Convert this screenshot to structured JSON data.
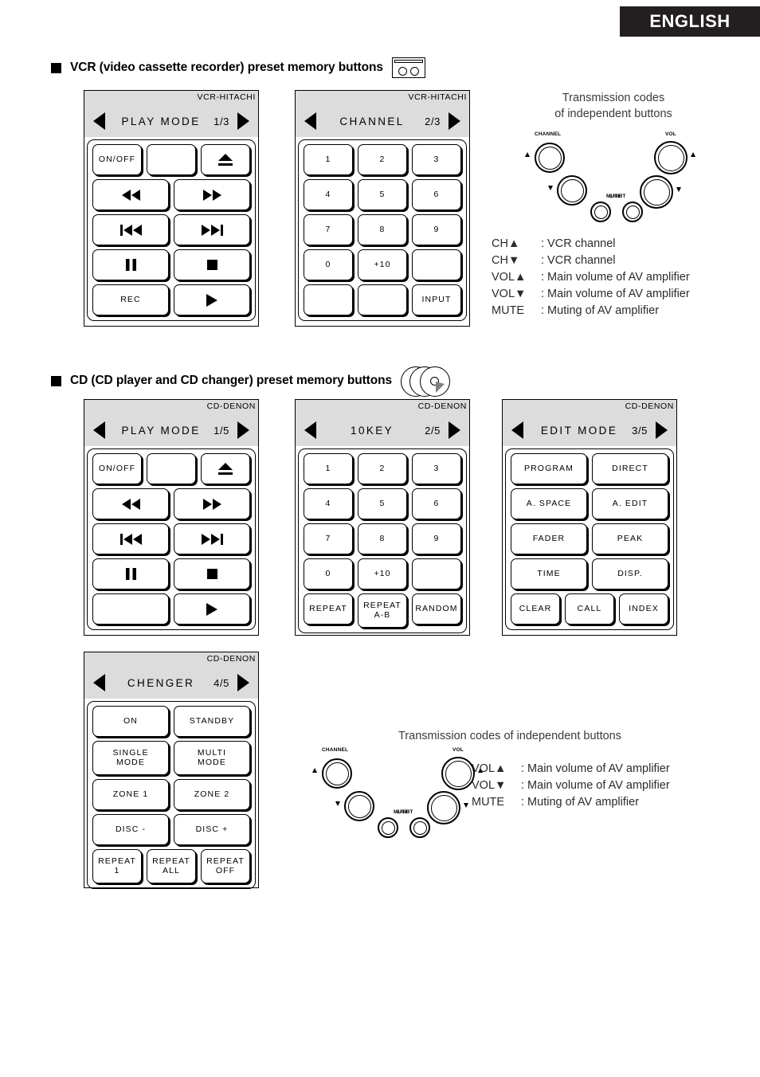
{
  "header": {
    "language": "ENGLISH"
  },
  "sections": [
    {
      "bullet_icon": "vhs-cassette-icon",
      "title": "VCR (video cassette recorder) preset memory buttons"
    },
    {
      "bullet_icon": "cd-discs-icon",
      "title": "CD (CD player and CD changer) preset memory buttons"
    }
  ],
  "vcr_panels": [
    {
      "brand": "VCR-HITACHI",
      "name": "PLAY MODE",
      "page": "1/3",
      "prev_icon": "triangle-left-icon",
      "next_icon": "triangle-right-icon",
      "rows": [
        [
          {
            "label": "ON/OFF",
            "type": "text",
            "span": 1
          },
          {
            "label": "",
            "type": "text",
            "span": 1
          },
          {
            "label": "",
            "type": "eject",
            "span": 1
          }
        ],
        [
          {
            "label": "",
            "type": "rew",
            "span": 2
          },
          {
            "label": "",
            "type": "ff",
            "span": 2
          }
        ],
        [
          {
            "label": "",
            "type": "prev",
            "span": 2
          },
          {
            "label": "",
            "type": "next",
            "span": 2
          }
        ],
        [
          {
            "label": "",
            "type": "pause",
            "span": 2
          },
          {
            "label": "",
            "type": "stop",
            "span": 2
          }
        ],
        [
          {
            "label": "REC",
            "type": "text",
            "span": 2
          },
          {
            "label": "",
            "type": "play",
            "span": 2
          }
        ]
      ]
    },
    {
      "brand": "VCR-HITACHI",
      "name": "CHANNEL",
      "page": "2/3",
      "prev_icon": "triangle-left-icon",
      "next_icon": "triangle-right-icon",
      "rows": [
        [
          {
            "label": "1",
            "type": "text",
            "span": 1
          },
          {
            "label": "2",
            "type": "text",
            "span": 1
          },
          {
            "label": "3",
            "type": "text",
            "span": 1
          }
        ],
        [
          {
            "label": "4",
            "type": "text",
            "span": 1
          },
          {
            "label": "5",
            "type": "text",
            "span": 1
          },
          {
            "label": "6",
            "type": "text",
            "span": 1
          }
        ],
        [
          {
            "label": "7",
            "type": "text",
            "span": 1
          },
          {
            "label": "8",
            "type": "text",
            "span": 1
          },
          {
            "label": "9",
            "type": "text",
            "span": 1
          }
        ],
        [
          {
            "label": "0",
            "type": "text",
            "span": 1
          },
          {
            "label": "+10",
            "type": "text",
            "span": 1
          },
          {
            "label": "",
            "type": "text",
            "span": 1
          }
        ],
        [
          {
            "label": "",
            "type": "text",
            "span": 1
          },
          {
            "label": "",
            "type": "text",
            "span": 1
          },
          {
            "label": "INPUT",
            "type": "text",
            "span": 1
          }
        ]
      ]
    }
  ],
  "cd_panels": [
    {
      "brand": "CD-DENON",
      "name": "PLAY MODE",
      "page": "1/5",
      "prev_icon": "triangle-left-icon",
      "next_icon": "triangle-right-icon",
      "rows": [
        [
          {
            "label": "ON/OFF",
            "type": "text",
            "span": 1
          },
          {
            "label": "",
            "type": "text",
            "span": 1
          },
          {
            "label": "",
            "type": "eject",
            "span": 1
          }
        ],
        [
          {
            "label": "",
            "type": "rew",
            "span": 2
          },
          {
            "label": "",
            "type": "ff",
            "span": 2
          }
        ],
        [
          {
            "label": "",
            "type": "prev",
            "span": 2
          },
          {
            "label": "",
            "type": "next",
            "span": 2
          }
        ],
        [
          {
            "label": "",
            "type": "pause",
            "span": 2
          },
          {
            "label": "",
            "type": "stop",
            "span": 2
          }
        ],
        [
          {
            "label": "",
            "type": "text",
            "span": 2
          },
          {
            "label": "",
            "type": "play",
            "span": 2
          }
        ]
      ]
    },
    {
      "brand": "CD-DENON",
      "name": "10KEY",
      "page": "2/5",
      "prev_icon": "triangle-left-icon",
      "next_icon": "triangle-right-icon",
      "rows": [
        [
          {
            "label": "1",
            "type": "text",
            "span": 1
          },
          {
            "label": "2",
            "type": "text",
            "span": 1
          },
          {
            "label": "3",
            "type": "text",
            "span": 1
          }
        ],
        [
          {
            "label": "4",
            "type": "text",
            "span": 1
          },
          {
            "label": "5",
            "type": "text",
            "span": 1
          },
          {
            "label": "6",
            "type": "text",
            "span": 1
          }
        ],
        [
          {
            "label": "7",
            "type": "text",
            "span": 1
          },
          {
            "label": "8",
            "type": "text",
            "span": 1
          },
          {
            "label": "9",
            "type": "text",
            "span": 1
          }
        ],
        [
          {
            "label": "0",
            "type": "text",
            "span": 1
          },
          {
            "label": "+10",
            "type": "text",
            "span": 1
          },
          {
            "label": "",
            "type": "text",
            "span": 1
          }
        ],
        [
          {
            "label": "REPEAT",
            "type": "text",
            "span": 1
          },
          {
            "label": "REPEAT\nA-B",
            "type": "text",
            "span": 1
          },
          {
            "label": "RANDOM",
            "type": "text",
            "span": 1
          }
        ]
      ]
    },
    {
      "brand": "CD-DENON",
      "name": "EDIT MODE",
      "page": "3/5",
      "prev_icon": "triangle-left-icon",
      "next_icon": "triangle-right-icon",
      "rows": [
        [
          {
            "label": "PROGRAM",
            "type": "text",
            "span": 2
          },
          {
            "label": "DIRECT",
            "type": "text",
            "span": 2
          }
        ],
        [
          {
            "label": "A. SPACE",
            "type": "text",
            "span": 2
          },
          {
            "label": "A. EDIT",
            "type": "text",
            "span": 2
          }
        ],
        [
          {
            "label": "FADER",
            "type": "text",
            "span": 2
          },
          {
            "label": "PEAK",
            "type": "text",
            "span": 2
          }
        ],
        [
          {
            "label": "TIME",
            "type": "text",
            "span": 2
          },
          {
            "label": "DISP.",
            "type": "text",
            "span": 2
          }
        ],
        [
          {
            "label": "CLEAR",
            "type": "text",
            "span": 1
          },
          {
            "label": "CALL",
            "type": "text",
            "span": 1
          },
          {
            "label": "INDEX",
            "type": "text",
            "span": 1
          }
        ]
      ]
    },
    {
      "brand": "CD-DENON",
      "name": "CHENGER",
      "page": "4/5",
      "prev_icon": "triangle-left-icon",
      "next_icon": "triangle-right-icon",
      "rows": [
        [
          {
            "label": "ON",
            "type": "text",
            "span": 2
          },
          {
            "label": "STANDBY",
            "type": "text",
            "span": 2
          }
        ],
        [
          {
            "label": "SINGLE\nMODE",
            "type": "text",
            "span": 2
          },
          {
            "label": "MULTI\nMODE",
            "type": "text",
            "span": 2
          }
        ],
        [
          {
            "label": "ZONE 1",
            "type": "text",
            "span": 2
          },
          {
            "label": "ZONE 2",
            "type": "text",
            "span": 2
          }
        ],
        [
          {
            "label": "DISC -",
            "type": "text",
            "span": 2
          },
          {
            "label": "DISC +",
            "type": "text",
            "span": 2
          }
        ],
        [
          {
            "label": "REPEAT\n1",
            "type": "text",
            "span": 1
          },
          {
            "label": "REPEAT\nALL",
            "type": "text",
            "span": 1
          },
          {
            "label": "REPEAT\nOFF",
            "type": "text",
            "span": 1
          }
        ]
      ]
    }
  ],
  "transmission_vcr": {
    "title_line1": "Transmission codes",
    "title_line2": "of independent buttons",
    "knob_labels": {
      "channel": "CHANNEL",
      "vol": "VOL",
      "mute": "MUTE",
      "light": "LIGHT"
    },
    "codes": [
      {
        "key": "CH▲",
        "value": ": VCR channel"
      },
      {
        "key": "CH▼",
        "value": ": VCR channel"
      },
      {
        "key": "VOL▲",
        "value": ": Main volume of AV amplifier"
      },
      {
        "key": "VOL▼",
        "value": ": Main volume of AV amplifier"
      },
      {
        "key": "MUTE",
        "value": ": Muting of AV amplifier"
      }
    ]
  },
  "transmission_cd": {
    "title_line1": "Transmission codes of independent buttons",
    "knob_labels": {
      "channel": "CHANNEL",
      "vol": "VOL",
      "mute": "MUTE",
      "light": "LIGHT"
    },
    "codes": [
      {
        "key": "VOL▲",
        "value": ": Main volume of AV amplifier"
      },
      {
        "key": "VOL▼",
        "value": ": Main volume of AV amplifier"
      },
      {
        "key": "MUTE",
        "value": ": Muting of AV amplifier"
      }
    ]
  },
  "colors": {
    "banner_bg": "#231f20",
    "panel_header_bg": "#dcdcdc",
    "text": "#000000",
    "caption_text": "#3a3a3a"
  }
}
